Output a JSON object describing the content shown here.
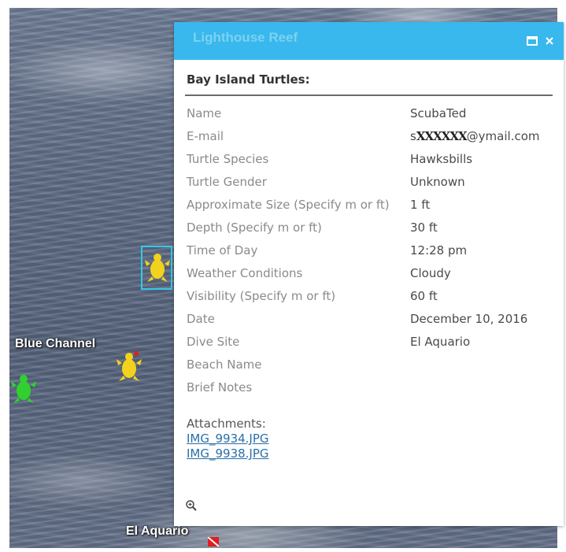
{
  "map": {
    "labels": {
      "lighthouse_reef": "Lighthouse Reef",
      "blue_channel": "Blue Channel",
      "el_aquario": "El Aquario"
    },
    "turtle_colors": {
      "selected": "#f2d21c",
      "other": "#2fd12f",
      "selection_box": "#35c8e6"
    }
  },
  "popup": {
    "header_color": "#38b8ec",
    "icons": {
      "maximize": "maximize-icon",
      "close": "close-icon",
      "zoom": "zoom-to-icon"
    },
    "section_title": "Bay Island Turtles:",
    "fields": [
      {
        "key": "Name",
        "value": "ScubaTed"
      },
      {
        "key": "E-mail",
        "value_prefix": "s",
        "value_redacted": "XXXXXX",
        "value_suffix": "@ymail.com"
      },
      {
        "key": "Turtle Species",
        "value": "Hawksbills"
      },
      {
        "key": "Turtle Gender",
        "value": "Unknown"
      },
      {
        "key": "Approximate Size (Specify m or ft)",
        "value": "1 ft"
      },
      {
        "key": "Depth (Specify m or ft)",
        "value": "30 ft"
      },
      {
        "key": "Time of Day",
        "value": "12:28 pm"
      },
      {
        "key": "Weather Conditions",
        "value": "Cloudy"
      },
      {
        "key": "Visibility (Specify m or ft)",
        "value": "60 ft"
      },
      {
        "key": "Date",
        "value": "December 10, 2016"
      },
      {
        "key": "Dive Site",
        "value": "El Aquario"
      },
      {
        "key": "Beach Name",
        "value": ""
      },
      {
        "key": "Brief Notes",
        "value": ""
      }
    ],
    "attachments_label": "Attachments:",
    "attachments": [
      "IMG_9934.JPG",
      "IMG_9938.JPG"
    ]
  }
}
